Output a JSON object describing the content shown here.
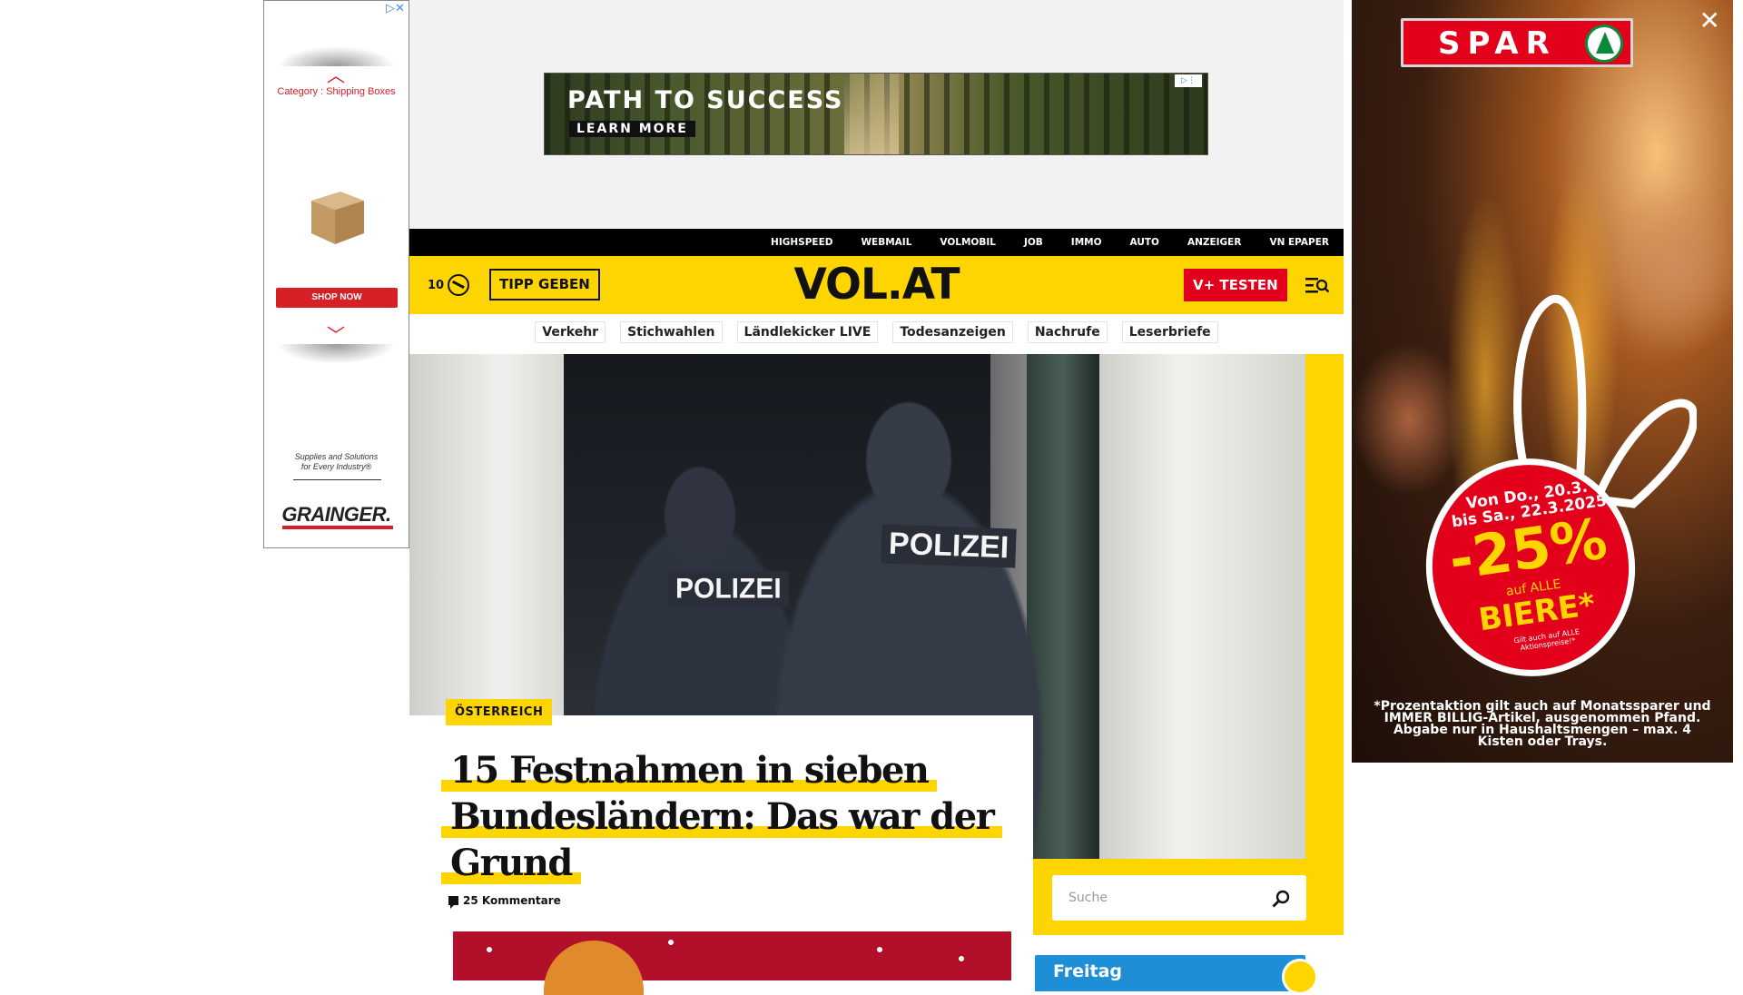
{
  "left_ad": {
    "ad_choice": "▷✕",
    "category": "Category : Shipping Boxes",
    "shop_now": "SHOP NOW",
    "tagline_1": "Supplies and Solutions",
    "tagline_2": "for Every Industry®",
    "brand": "GRAINGER.",
    "chevron_up": "︿",
    "chevron_down": "﹀",
    "brand_color": "#d61f26"
  },
  "top_banner": {
    "headline": "PATH TO SUCCESS",
    "cta": "LEARN MORE",
    "ad_icons": "▷⋮"
  },
  "service_nav": [
    "HIGHSPEED",
    "WEBMAIL",
    "VOLMOBIL",
    "JOB",
    "IMMO",
    "AUTO",
    "ANZEIGER",
    "VN EPAPER"
  ],
  "header": {
    "temperature": "10",
    "weather_icon": "partly-cloudy-icon",
    "tip_button": "TIPP GEBEN",
    "logo": "VOL.AT",
    "vplus_button": "V+ TESTEN",
    "menu_icon": "menu-search-icon",
    "brand_yellow": "#ffd500",
    "accent_red": "#e2001a"
  },
  "topics": [
    "Verkehr",
    "Stichwahlen",
    "Ländlekicker LIVE",
    "Todesanzeigen",
    "Nachrufe",
    "Leserbriefe"
  ],
  "hero": {
    "photo_label_left": "POLIZEI",
    "photo_label_right": "POLIZEI",
    "category": "ÖSTERREICH",
    "title": "15 Festnahmen in sieben Bundesländern: Das war der Grund",
    "comments": "25 Kommentare",
    "comment_icon": "comment-icon"
  },
  "search": {
    "placeholder": "Suche",
    "icon": "search-icon"
  },
  "widget": {
    "day": "Freitag"
  },
  "right_ad": {
    "close": "✕",
    "brand": "SPAR",
    "date_line_1": "Von Do., 20.3.",
    "date_line_2": "bis Sa., 22.3.2025",
    "discount": "-25%",
    "auf": "auf ALLE",
    "product": "BIERE*",
    "small_note": "Gilt auch auf ALLE Aktionspreise!*",
    "disclaimer": "*Prozentaktion gilt auch auf Monatssparer und IMMER BILLIG-Artikel, ausgenommen Pfand. Abgabe nur in Haushaltsmengen – max. 4 Kisten oder Trays."
  }
}
